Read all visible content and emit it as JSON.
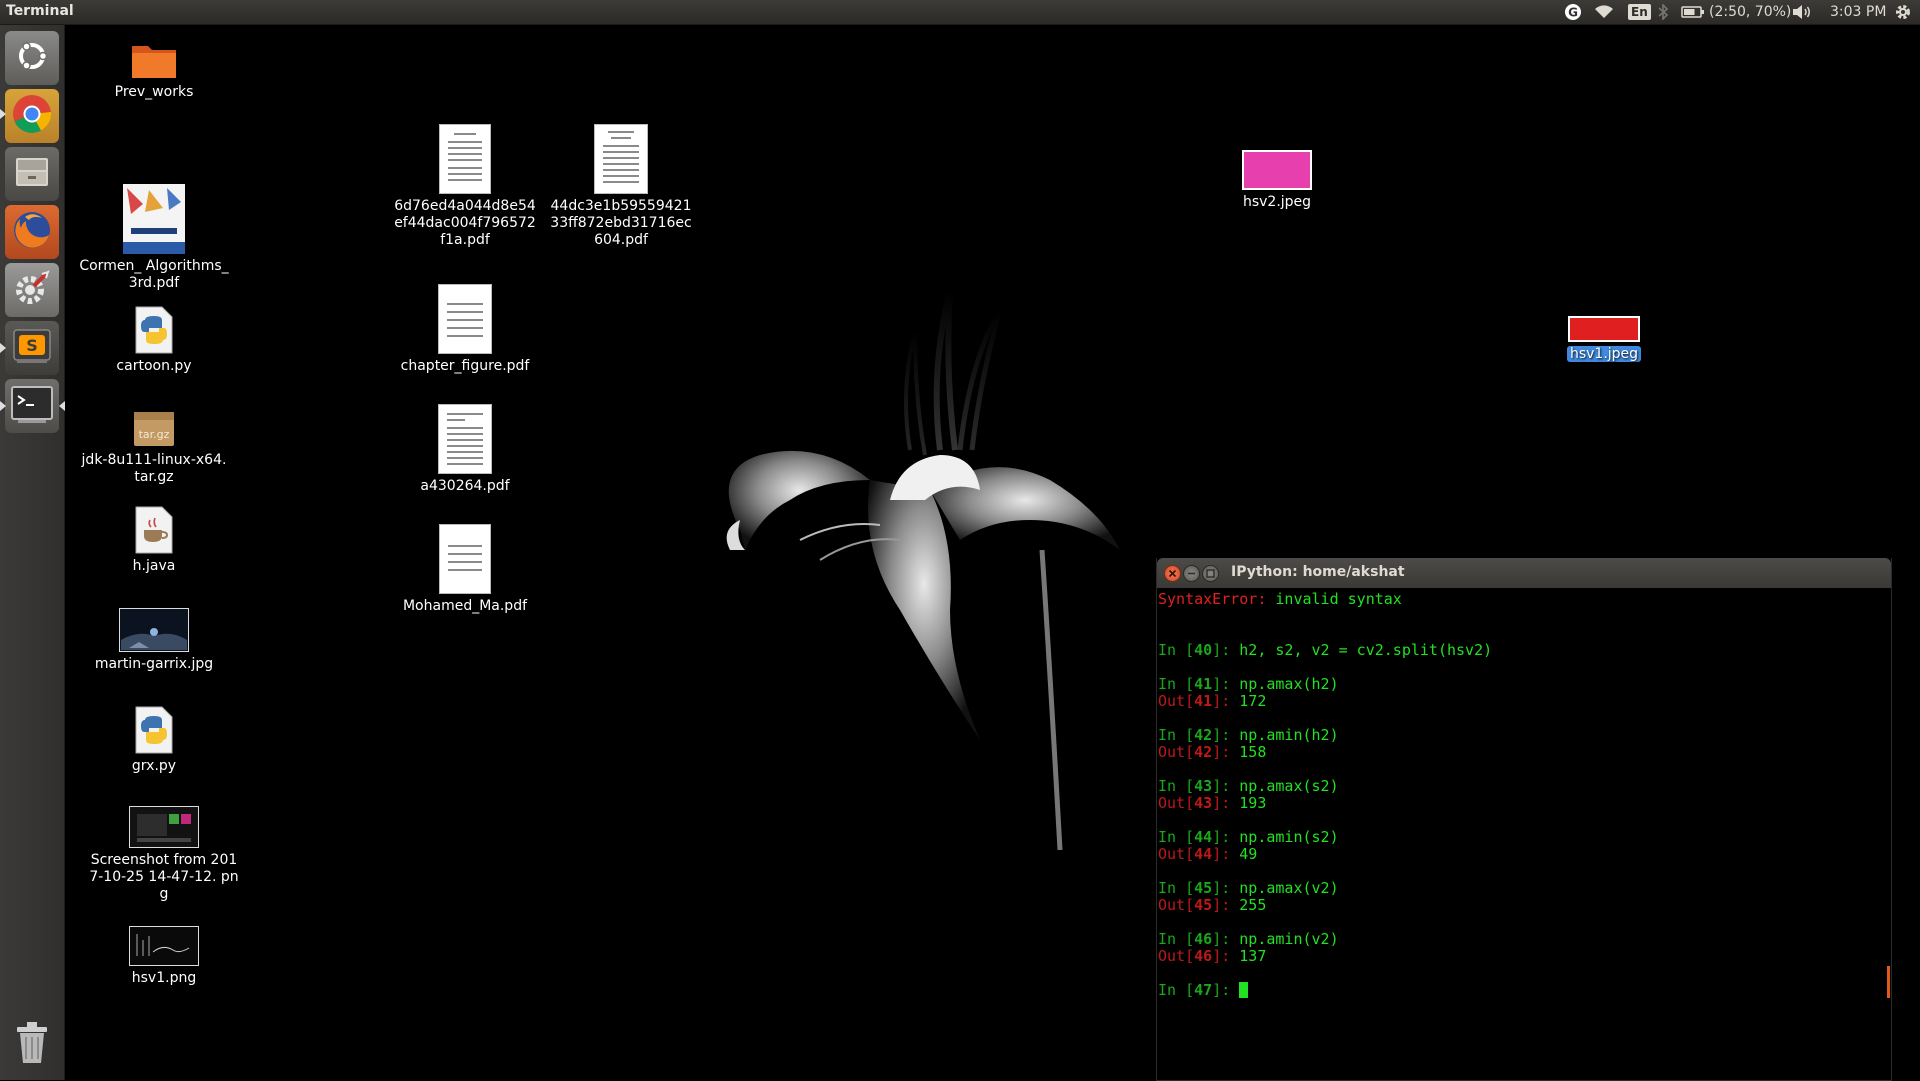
{
  "topbar": {
    "app_title": "Terminal",
    "keyboard_layout": "En",
    "battery": "(2:50, 70%)",
    "battery_percent": 70,
    "clock": "3:03 PM",
    "icons": [
      "g-icon",
      "wifi-icon",
      "keyboard-icon",
      "bluetooth-icon",
      "battery-icon",
      "volume-icon",
      "gear-icon"
    ]
  },
  "launcher": {
    "items": [
      {
        "name": "Search your computer",
        "icon": "ubuntu-dash-icon"
      },
      {
        "name": "Google Chrome",
        "icon": "chrome-icon"
      },
      {
        "name": "Files",
        "icon": "files-icon"
      },
      {
        "name": "Firefox Web Browser",
        "icon": "firefox-icon"
      },
      {
        "name": "System Settings",
        "icon": "settings-icon"
      },
      {
        "name": "Sublime Text",
        "icon": "sublime-icon"
      },
      {
        "name": "Terminal",
        "icon": "terminal-icon"
      },
      {
        "name": "Trash",
        "icon": "trash-icon"
      }
    ]
  },
  "desktop": {
    "icons": [
      {
        "label": "Prev_works",
        "type": "folder"
      },
      {
        "label": "Cormen_ Algorithms_3rd.pdf",
        "type": "pdf-cover"
      },
      {
        "label": "cartoon.py",
        "type": "python"
      },
      {
        "label": "jdk-8u111-linux-x64.tar.gz",
        "type": "archive",
        "badge": "tar.gz"
      },
      {
        "label": "h.java",
        "type": "java"
      },
      {
        "label": "martin-garrix.jpg",
        "type": "image"
      },
      {
        "label": "grx.py",
        "type": "python"
      },
      {
        "label": "Screenshot from 2017-10-25 14-47-12. png",
        "type": "image"
      },
      {
        "label": "hsv1.png",
        "type": "image"
      },
      {
        "label": "6d76ed4a044d8e54 ef44dac004f796572 f1a.pdf",
        "type": "pdf"
      },
      {
        "label": "44dc3e1b59559421 33ff872ebd31716ec 604.pdf",
        "type": "pdf"
      },
      {
        "label": "chapter_figure.pdf",
        "type": "pdf"
      },
      {
        "label": "a430264.pdf",
        "type": "pdf"
      },
      {
        "label": "Mohamed_Ma.pdf",
        "type": "pdf"
      },
      {
        "label": "hsv2.jpeg",
        "type": "image",
        "color": "#e83fae"
      },
      {
        "label": "hsv1.jpeg",
        "type": "image",
        "color": "#e02020",
        "selected": true
      }
    ]
  },
  "terminal": {
    "title": "IPython: home/akshat",
    "error_line": {
      "type": "SyntaxError:",
      "message": " invalid syntax"
    },
    "cells": [
      {
        "n": "40",
        "input": "h2, s2, v2 = cv2.split(hsv2)",
        "output": null
      },
      {
        "n": "41",
        "input": "np.amax(h2)",
        "output": "172"
      },
      {
        "n": "42",
        "input": "np.amin(h2)",
        "output": "158"
      },
      {
        "n": "43",
        "input": "np.amax(s2)",
        "output": "193"
      },
      {
        "n": "44",
        "input": "np.amin(s2)",
        "output": "49"
      },
      {
        "n": "45",
        "input": "np.amax(v2)",
        "output": "255"
      },
      {
        "n": "46",
        "input": "np.amin(v2)",
        "output": "137"
      }
    ],
    "prompt": {
      "in": "In [",
      "out": "Out[",
      "close": "]: ",
      "current": "47"
    }
  },
  "colors": {
    "prompt_in": "#19a819",
    "prompt_out": "#c01818",
    "text": "#22e022",
    "error": "#e02020",
    "selection": "#3f8ae0"
  }
}
